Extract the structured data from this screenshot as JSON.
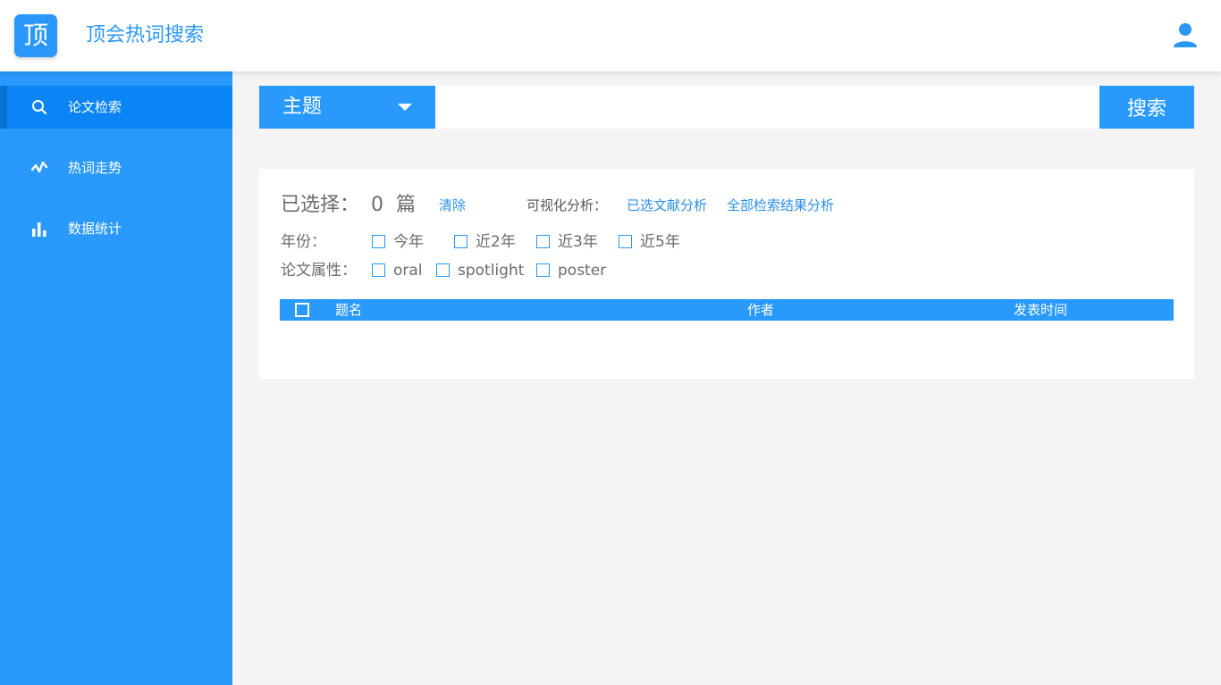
{
  "header": {
    "logo_char": "顶",
    "title": "顶会热词搜索",
    "user_icon": "user-icon"
  },
  "sidebar": {
    "items": [
      {
        "label": "论文检索",
        "icon": "search-icon",
        "active": true
      },
      {
        "label": "热词走势",
        "icon": "trend-icon",
        "active": false
      },
      {
        "label": "数据统计",
        "icon": "bar-chart-icon",
        "active": false
      }
    ]
  },
  "search": {
    "select_value": "主题",
    "input_value": "",
    "button_label": "搜索"
  },
  "panel": {
    "selected_label": "已选择：",
    "selected_count": "0",
    "selected_unit": "篇",
    "clear_label": "清除",
    "viz_label": "可视化分析：",
    "viz_selected": "已选文献分析",
    "viz_all": "全部检索结果分析",
    "year_label": "年份：",
    "year_options": [
      "今年",
      "近2年",
      "近3年",
      "近5年"
    ],
    "attr_label": "论文属性：",
    "attr_options": [
      "oral",
      "spotlight",
      "poster"
    ]
  },
  "table": {
    "columns": [
      "题名",
      "作者",
      "发表时间"
    ]
  },
  "colors": {
    "primary": "#2999fb",
    "active_nav": "#0a85f3",
    "link": "#2b8fe9",
    "background": "#f4f4f4"
  }
}
